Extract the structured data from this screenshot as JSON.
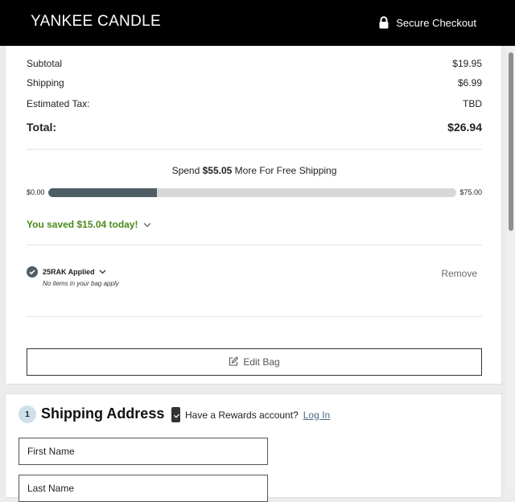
{
  "header": {
    "logo": "YANKEE CANDLE",
    "secure_label": "Secure Checkout",
    "background": "#000000"
  },
  "summary": {
    "subtotal_label": "Subtotal",
    "subtotal_value": "$19.95",
    "shipping_label": "Shipping",
    "shipping_value": "$6.99",
    "tax_label": "Estimated Tax:",
    "tax_value": "TBD",
    "total_label": "Total:",
    "total_value": "$26.94"
  },
  "free_shipping": {
    "prefix": "Spend",
    "amount": "$55.05",
    "suffix": "More For Free Shipping",
    "min_label": "$0.00",
    "max_label": "$75.00",
    "progress": 0.266,
    "fill_color": "#4f5d66"
  },
  "savings": {
    "text": "You saved $15.04 today!",
    "color": "#4a8a1c"
  },
  "promo": {
    "code_text": "25RAK Applied",
    "note": "No items in your bag apply",
    "remove_label": "Remove"
  },
  "edit_bag_label": "Edit Bag",
  "shipping_address": {
    "step_number": "1",
    "title": "Shipping Address",
    "rewards_prompt": "Have a Rewards account?",
    "login_label": "Log In",
    "first_name_label": "First Name",
    "last_name_label": "Last Name"
  },
  "icons": [
    "lock-icon",
    "chevron-down-icon",
    "check-circle-icon",
    "edit-icon",
    "rewards-card-icon"
  ]
}
